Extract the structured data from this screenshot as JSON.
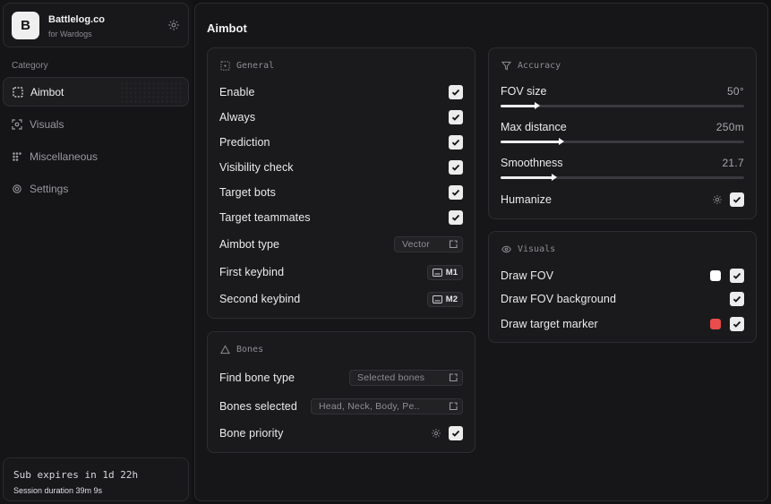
{
  "brand": {
    "logo_letter": "B",
    "name": "Battlelog.co",
    "subtitle": "for Wardogs"
  },
  "sidebar": {
    "category_label": "Category",
    "items": [
      {
        "label": "Aimbot",
        "icon": "crosshair-frame-icon",
        "active": true
      },
      {
        "label": "Visuals",
        "icon": "scan-eye-icon",
        "active": false
      },
      {
        "label": "Miscellaneous",
        "icon": "grid-dots-icon",
        "active": false
      },
      {
        "label": "Settings",
        "icon": "gear-icon",
        "active": false
      }
    ]
  },
  "subscription": {
    "expires": "Sub expires in 1d 22h",
    "session": "Session duration 39m  9s"
  },
  "main": {
    "title": "Aimbot"
  },
  "general": {
    "title": "General",
    "toggles": [
      {
        "label": "Enable",
        "checked": true
      },
      {
        "label": "Always",
        "checked": true
      },
      {
        "label": "Prediction",
        "checked": true
      },
      {
        "label": "Visibility check",
        "checked": true
      },
      {
        "label": "Target bots",
        "checked": true
      },
      {
        "label": "Target teammates",
        "checked": true
      }
    ],
    "aimbot_type": {
      "label": "Aimbot type",
      "value": "Vector"
    },
    "first_keybind": {
      "label": "First keybind",
      "key": "M1"
    },
    "second_keybind": {
      "label": "Second keybind",
      "key": "M2"
    }
  },
  "bones": {
    "title": "Bones",
    "find_bone_type": {
      "label": "Find bone type",
      "value": "Selected bones"
    },
    "bones_selected": {
      "label": "Bones selected",
      "value": "Head, Neck, Body, Pe.."
    },
    "bone_priority": {
      "label": "Bone priority",
      "checked": true
    }
  },
  "accuracy": {
    "title": "Accuracy",
    "sliders": [
      {
        "label": "FOV size",
        "value": "50°",
        "fraction": 0.15
      },
      {
        "label": "Max distance",
        "value": "250m",
        "fraction": 0.25
      },
      {
        "label": "Smoothness",
        "value": "21.7",
        "fraction": 0.22
      }
    ],
    "humanize": {
      "label": "Humanize",
      "checked": true
    }
  },
  "visuals": {
    "title": "Visuals",
    "items": [
      {
        "label": "Draw FOV",
        "checked": true,
        "color": "#ffffff"
      },
      {
        "label": "Draw FOV background",
        "checked": true,
        "color": null
      },
      {
        "label": "Draw target marker",
        "checked": true,
        "color": "#e84c4c"
      }
    ]
  }
}
